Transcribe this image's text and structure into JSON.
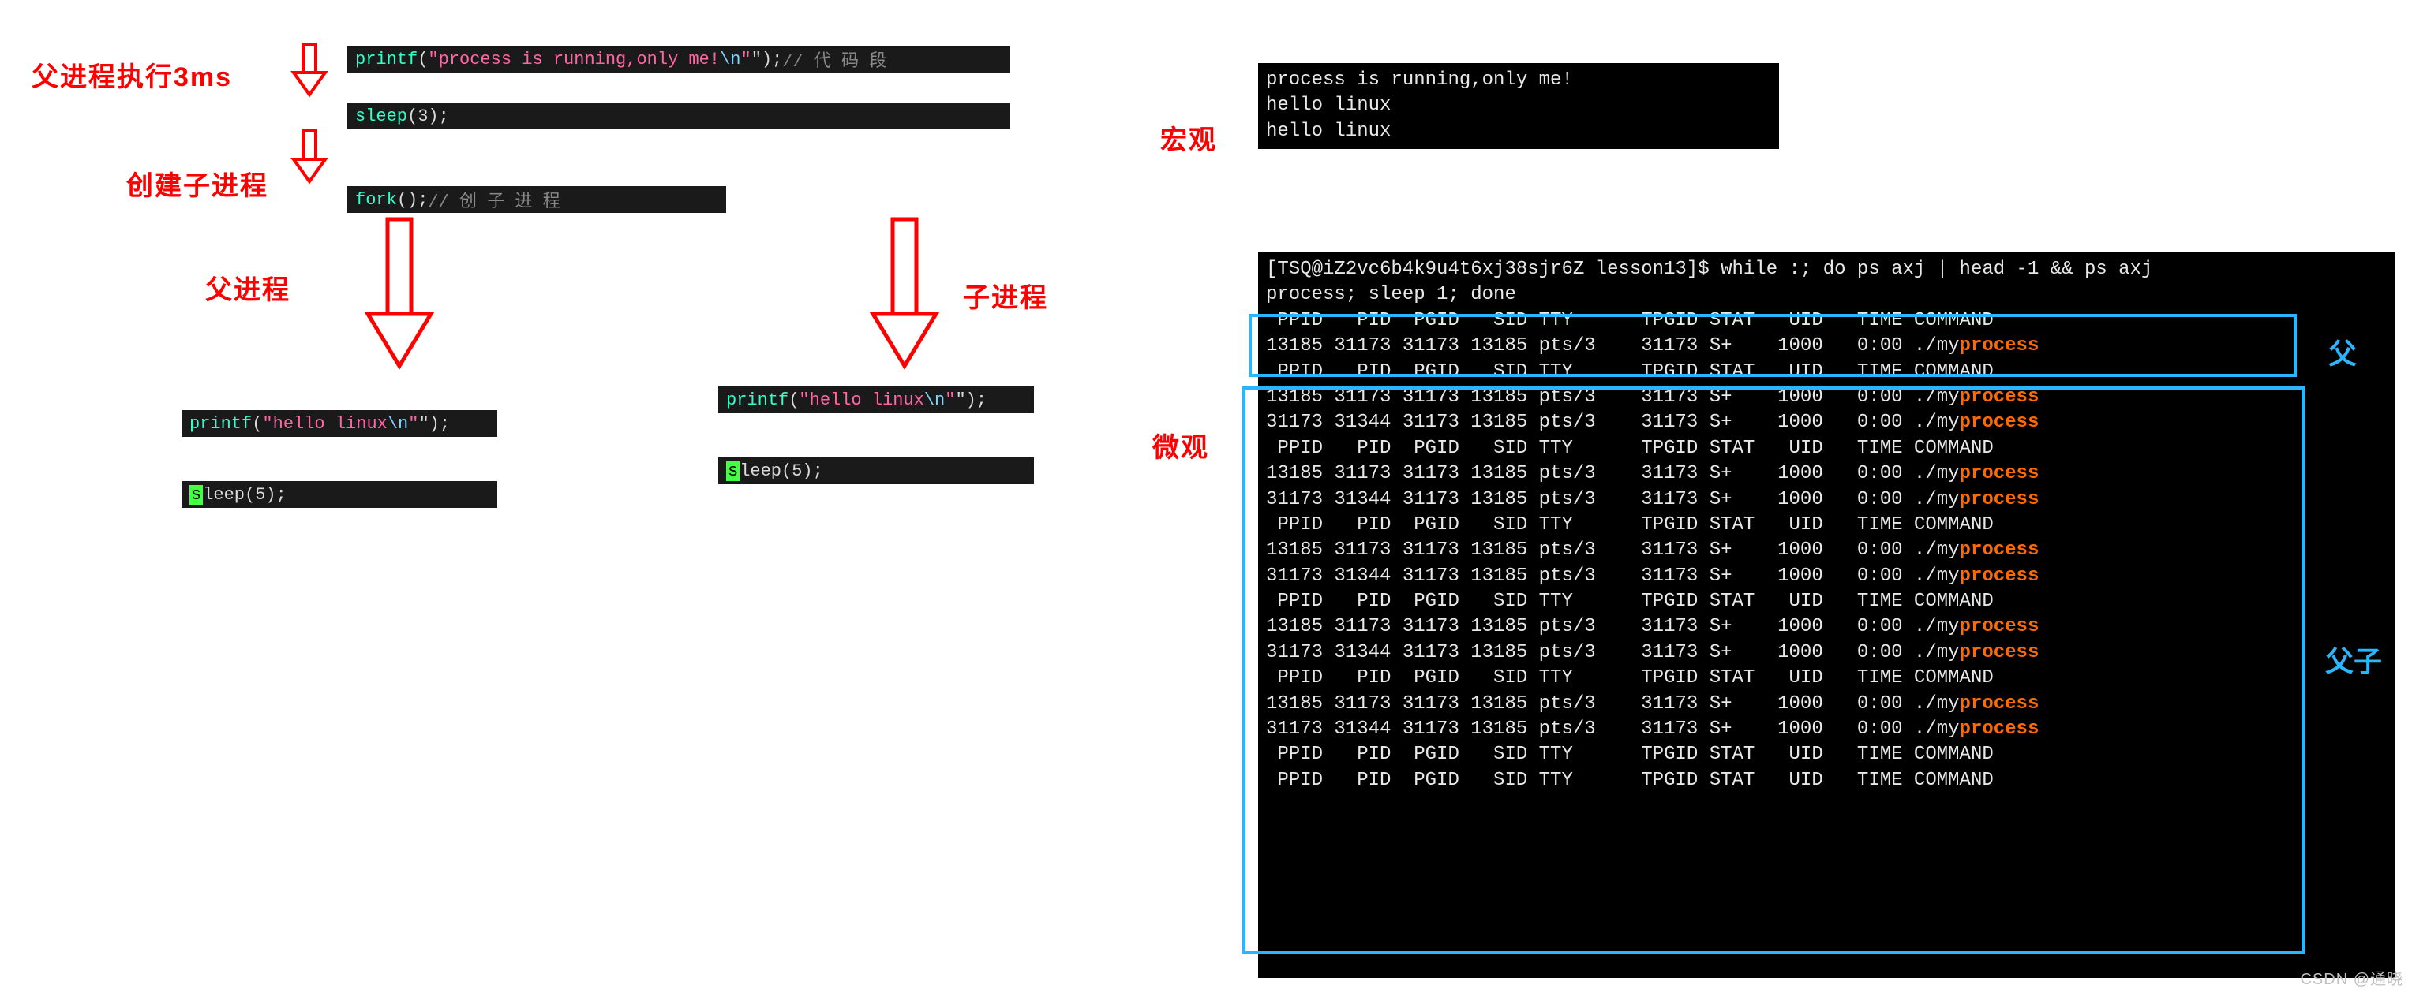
{
  "left": {
    "label_3ms": "父进程执行3ms",
    "label_fork": "创建子进程",
    "label_parent": "父进程",
    "label_child": "子进程",
    "code_printf1_fn": "printf",
    "code_printf1_open": "(",
    "code_printf1_q": "\"",
    "code_printf1_str": "process is running,only me!",
    "code_printf1_esc": "\\n",
    "code_printf1_close": "\");",
    "code_printf1_cmt": "// 代 码 段",
    "code_sleep3_fn": "sleep",
    "code_sleep3_rest": "(3);",
    "code_fork_fn": "fork",
    "code_fork_rest": "();",
    "code_fork_cmt": "// 创 子 进 程",
    "code_hello_fn": "printf",
    "code_hello_open": "(",
    "code_hello_q": "\"",
    "code_hello_str": "hello linux",
    "code_hello_esc": "\\n",
    "code_hello_close": "\");",
    "code_sleep5_s": "s",
    "code_sleep5_rest": "leep(5);"
  },
  "right": {
    "label_macro": "宏观",
    "label_micro": "微观",
    "label_parent_blue": "父",
    "label_both_blue": "父子",
    "term1_lines": [
      "process is running,only me!",
      "hello linux",
      "hello linux"
    ],
    "term2_prompt": "[TSQ@iZ2vc6b4k9u4t6xj38sjr6Z lesson13]$ while :; do ps axj | head -1 && ps axj",
    "term2_cont": "process; sleep 1; done",
    "header": " PPID   PID  PGID   SID TTY      TPGID STAT   UID   TIME COMMAND",
    "row_parent": "13185 31173 31173 13185 pts/3    31173 S+    1000   0:00 ./my",
    "row_child": "31173 31344 31173 13185 pts/3    31173 S+    1000   0:00 ./my",
    "row_tail": "process",
    "tail_headers": 2
  },
  "watermark": "CSDN @通晓"
}
